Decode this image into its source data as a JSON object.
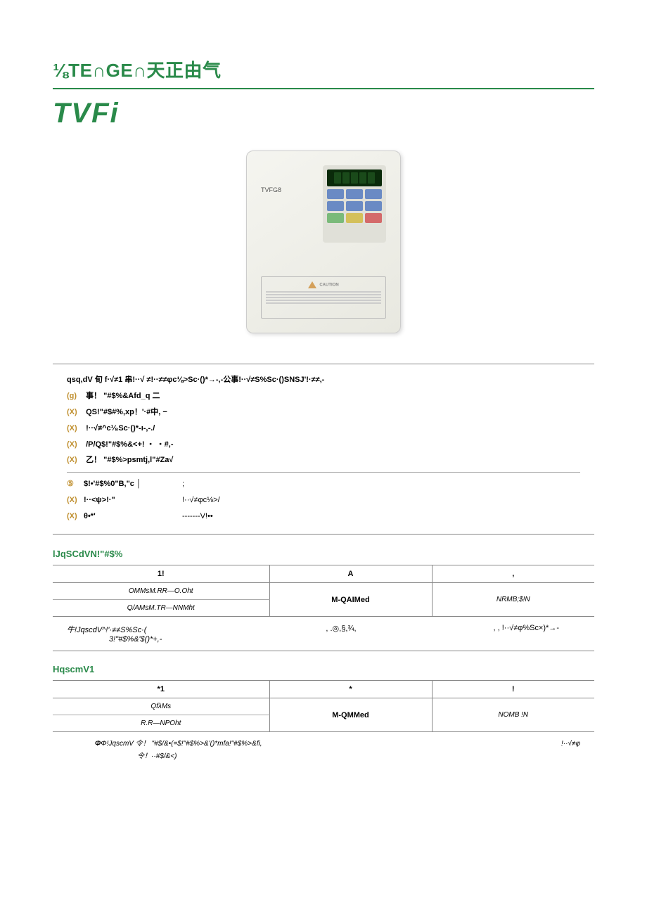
{
  "header": {
    "logo": "⅛TE∩GE∩天正由气"
  },
  "product": {
    "title": "TVFi",
    "device_label": "TVFG8"
  },
  "features": {
    "main": "qsq,dV 旬 f·√≠1 串!··√ ≠!··≠≠φc⅛>Sc·()*→-,-公事!··√≠S%Sc·()SNSJ'!·≠≠,-",
    "items": [
      {
        "mark": "(g)",
        "text": "事！ \"#$%&Afd_q 二"
      },
      {
        "mark": "(X)",
        "text": "QS!\"#$#%,xp！'·#中, −"
      },
      {
        "mark": "(X)",
        "text": "        !··√≠^c¹⁄₈Sc·()*-ı-,-./"
      },
      {
        "mark": "(X)",
        "text": "/P/Q$!\"#$%&<+! ・ ・#,-"
      },
      {
        "mark": "(X)",
        "text": "乙！ \"#$%>psmtj,l\"#Za√"
      }
    ],
    "items2": [
      {
        "mark": "⑤",
        "col1": "$!•'#$%0\"B,\"c │",
        "col2": ";"
      },
      {
        "mark": "(X)",
        "col1": "!··<ψ>!·\"",
        "col2": "!··√≠φc⅛>/"
      },
      {
        "mark": "(X)",
        "col1": "θ•*'",
        "col2": "-------V!••"
      }
    ]
  },
  "table1": {
    "title": "lJqSCdVN!\"#$%",
    "headers": [
      "1!",
      "A",
      ","
    ],
    "rows": [
      {
        "c1a": "OMMsM.RR—O.Oht",
        "c1b": "Q/AMsM.TR—NNMht",
        "c2": "M-QAIMed",
        "c3": "NRMB;$!N"
      }
    ],
    "note": {
      "n1a": "牛!JqscdV^!'·≠≠S%Sc·(",
      "n1b": "3!\"#$%&'$()*+,-",
      "n2": ",      .◎,§,¾,",
      "n3": ",   ,          !··√≠φ%Sc×)*→-"
    }
  },
  "table2": {
    "title": "HqscmV1",
    "headers": [
      "*1",
      "*",
      "!"
    ],
    "rows": [
      {
        "c1a": "QfλMs",
        "c1b": "R.R—NPOht",
        "c2": "M-QMMed",
        "c3": "NOMB       !N"
      }
    ],
    "note": {
      "r1a": "Φ!JqscmV 令！ \"#$/&•(=$!\"#$%>&'()*mfa!\"#$%>&fi,",
      "r1b": "!··√≠φ",
      "r2": "令！··#$/&<)"
    }
  }
}
